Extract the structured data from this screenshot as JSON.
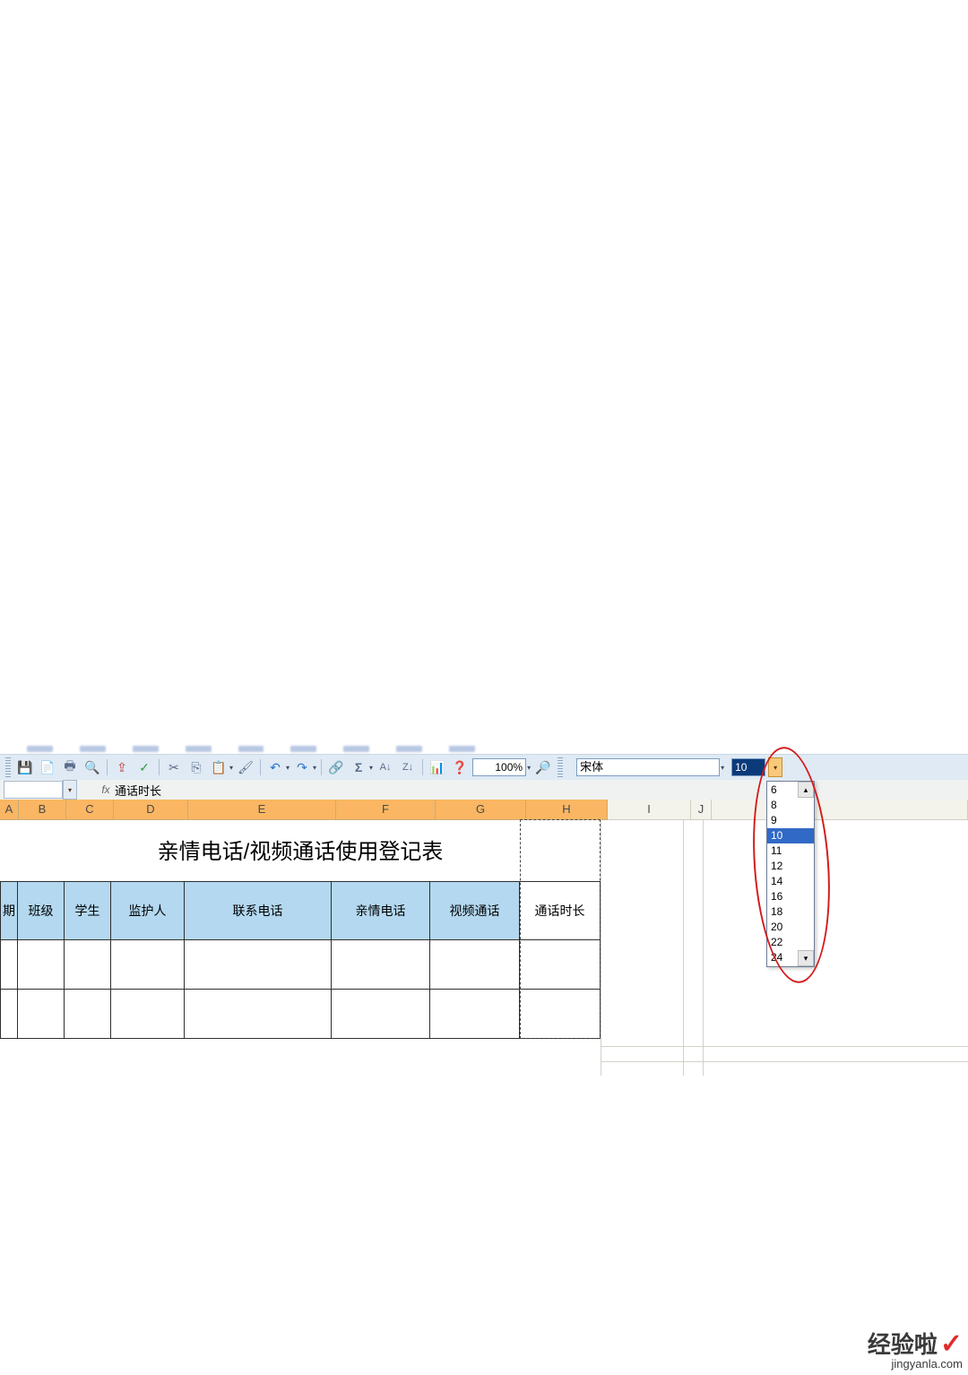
{
  "toolbar": {
    "zoom": "100%",
    "font_name": "宋体",
    "font_size": "10"
  },
  "formula_bar": {
    "cell_ref": "",
    "value": "通话时长"
  },
  "columns": [
    "A",
    "B",
    "C",
    "D",
    "E",
    "F",
    "G",
    "H",
    "I",
    "J"
  ],
  "sheet_title": "亲情电话/视频通话使用登记表",
  "table_headers": [
    "期",
    "班级",
    "学生",
    "监护人",
    "联系电话",
    "亲情电话",
    "视频通话",
    "通话时长"
  ],
  "font_size_dropdown": {
    "options": [
      "6",
      "8",
      "9",
      "10",
      "11",
      "12",
      "14",
      "16",
      "18",
      "20",
      "22",
      "24"
    ],
    "selected": "10"
  },
  "watermark": {
    "brand": "经验啦",
    "url": "jingyanla.com"
  }
}
